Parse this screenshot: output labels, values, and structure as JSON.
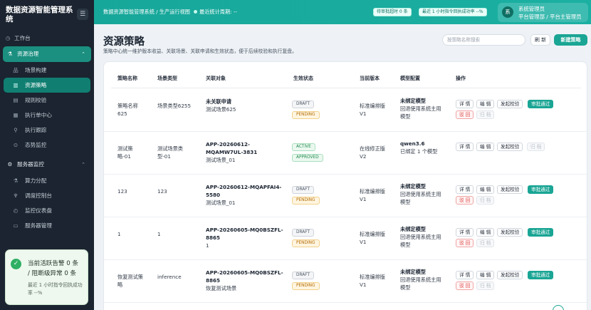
{
  "sidebar": {
    "brand": "数据资源智能管理系统",
    "menu_toggle": "☰",
    "items": [
      {
        "type": "item",
        "icon": "◷",
        "icon_name": "dashboard-icon",
        "label": "工作台"
      },
      {
        "type": "group",
        "icon": "⚗",
        "icon_name": "resource-icon",
        "label": "资源治理",
        "active": true,
        "chevron": "⌃"
      },
      {
        "type": "sub",
        "icon": "品",
        "icon_name": "scene-icon",
        "label": "场景构建"
      },
      {
        "type": "sub",
        "icon": "▥",
        "icon_name": "policy-icon",
        "label": "资源策略",
        "active": true
      },
      {
        "type": "sub",
        "icon": "▤",
        "icon_name": "rules-icon",
        "label": "规则校验"
      },
      {
        "type": "sub",
        "icon": "▦",
        "icon_name": "exec-center-icon",
        "label": "执行单中心"
      },
      {
        "type": "sub",
        "icon": "⚲",
        "icon_name": "trace-icon",
        "label": "执行跟踪"
      },
      {
        "type": "sub",
        "icon": "⊙",
        "icon_name": "monitor-icon",
        "label": "态势监控"
      },
      {
        "type": "group",
        "icon": "⚙",
        "icon_name": "server-icon",
        "label": "服务器监控",
        "chevron": "⌃"
      },
      {
        "type": "sub",
        "icon": "⚗",
        "icon_name": "compute-icon",
        "label": "算力分配"
      },
      {
        "type": "sub",
        "icon": "♆",
        "icon_name": "schedule-icon",
        "label": "调度控制台"
      },
      {
        "type": "sub",
        "icon": "◴",
        "icon_name": "gauge-icon",
        "label": "监控仪表盘"
      },
      {
        "type": "sub",
        "icon": "▭",
        "icon_name": "server-manage-icon",
        "label": "服务器管理"
      }
    ],
    "alert": {
      "check_icon": "✓",
      "line1": "当前活跃告警 0 条",
      "line2": "/ 阻断级异常 0 条",
      "line3": "最近 1 小时指令回执成功率 --%"
    }
  },
  "topbar": {
    "breadcrumb": "数据资源智能管理系统 / 生产运行视图",
    "last_stat": "最近统计周期: --",
    "pill_pending": "待审批超时 0 条",
    "pill_success": "最近 1 小时指令回执成功率 --%",
    "user_avatar": "系",
    "user_name": "系统管理员",
    "user_role": "平台管理部 / 平台主管理员"
  },
  "header": {
    "title": "资源策略",
    "description": "策略中心统一维护版本收益、关联场景、关联申请和生效状态，便于后续校验和执行复盘。",
    "search_placeholder": "按策略名称搜索",
    "refresh_label": "刷 新",
    "new_label": "新建策略"
  },
  "table": {
    "columns": [
      "策略名称",
      "场景类型",
      "关联对象",
      "生效状态",
      "当前版本",
      "模型配置",
      "操作"
    ],
    "ops": {
      "detail": "详 情",
      "edit": "编 辑",
      "validate": "发起校验",
      "approve": "审批通过",
      "reject": "驳 回",
      "archive": "归 档"
    },
    "rows": [
      {
        "name": "策略名称\n625",
        "scene": "场景类型6255",
        "obj_title": "未关联申请",
        "obj_sub": "测试场景625",
        "status1": "DRAFT",
        "status2": "PENDING",
        "version": "标准编排版\nV1",
        "model_title": "未绑定模型",
        "model_sub": "回退使用系统主用\n模型",
        "variant": "pending"
      },
      {
        "name": "测试策\n略-01",
        "scene": "测试场景类\n型-01",
        "obj_title": "APP-20260612-\nMQAMW7UL-3831",
        "obj_sub": "测试场景_01",
        "status1": "ACTIVE",
        "status2": "APPROVED",
        "version": "在线修正版\nV2",
        "model_title": "qwen3.6",
        "model_sub": "已绑定 1 个模型",
        "variant": "approved"
      },
      {
        "name": "123",
        "scene": "123",
        "obj_title": "APP-20260612-MQAPFAI4-\n5580",
        "obj_sub": "测试场景_01",
        "status1": "DRAFT",
        "status2": "PENDING",
        "version": "标准编排版\nV1",
        "model_title": "未绑定模型",
        "model_sub": "回退使用系统主用\n模型",
        "variant": "pending"
      },
      {
        "name": "1",
        "scene": "1",
        "obj_title": "APP-20260605-MQ0BSZFL-\n8865",
        "obj_sub": "1",
        "status1": "DRAFT",
        "status2": "PENDING",
        "version": "标准编排版\nV1",
        "model_title": "未绑定模型",
        "model_sub": "回退使用系统主用\n模型",
        "variant": "pending"
      },
      {
        "name": "恢复测试策\n略",
        "scene": "inference",
        "obj_title": "APP-20260605-MQ0BSZFL-\n8865",
        "obj_sub": "恢复测试场景",
        "status1": "DRAFT",
        "status2": "PENDING",
        "version": "标准编排版\nV1",
        "model_title": "未绑定模型",
        "model_sub": "回退使用系统主用\n模型",
        "variant": "pending"
      }
    ]
  }
}
